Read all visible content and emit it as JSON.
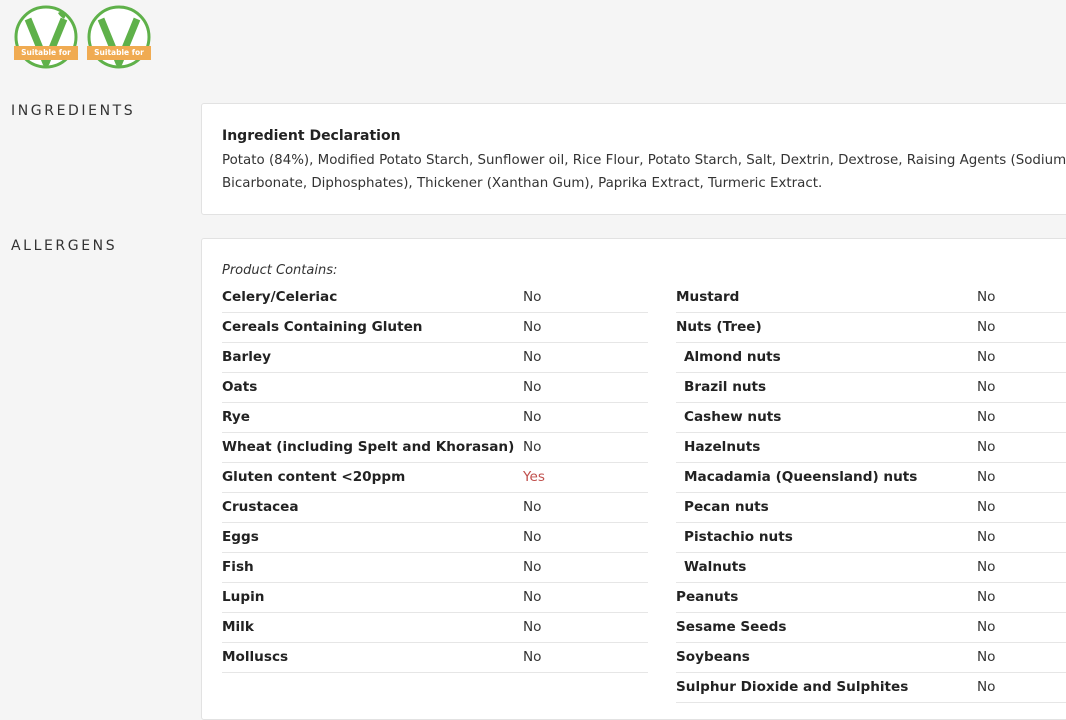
{
  "badges": [
    {
      "label": "Suitable for",
      "icon": "vegetarian-v-icon",
      "color": "#5fb14a",
      "accent": "#f0ab52"
    },
    {
      "label": "Suitable for",
      "icon": "vegan-v-icon",
      "color": "#5fb14a",
      "accent": "#f0ab52"
    }
  ],
  "ingredients": {
    "heading": "INGREDIENTS",
    "declaration_title": "Ingredient Declaration",
    "declaration_text": "Potato (84%), Modified Potato Starch, Sunflower oil, Rice Flour, Potato Starch, Salt, Dextrin, Dextrose, Raising Agents (Sodium Bicarbonate, Diphosphates), Thickener (Xanthan Gum), Paprika Extract, Turmeric Extract."
  },
  "allergens": {
    "heading": "ALLERGENS",
    "contains_label": "Product Contains:",
    "left": [
      {
        "name": "Celery/Celeriac",
        "value": "No"
      },
      {
        "name": "Cereals Containing Gluten",
        "value": "No"
      },
      {
        "name": "Barley",
        "value": "No"
      },
      {
        "name": "Oats",
        "value": "No"
      },
      {
        "name": "Rye",
        "value": "No"
      },
      {
        "name": "Wheat (including Spelt and Khorasan)",
        "value": "No"
      },
      {
        "name": "Gluten content <20ppm",
        "value": "Yes"
      },
      {
        "name": "Crustacea",
        "value": "No"
      },
      {
        "name": "Eggs",
        "value": "No"
      },
      {
        "name": "Fish",
        "value": "No"
      },
      {
        "name": "Lupin",
        "value": "No"
      },
      {
        "name": "Milk",
        "value": "No"
      },
      {
        "name": "Molluscs",
        "value": "No"
      }
    ],
    "right": [
      {
        "name": "Mustard",
        "value": "No"
      },
      {
        "name": "Nuts (Tree)",
        "value": "No"
      },
      {
        "name": "Almond nuts",
        "value": "No"
      },
      {
        "name": "Brazil nuts",
        "value": "No"
      },
      {
        "name": "Cashew nuts",
        "value": "No"
      },
      {
        "name": "Hazelnuts",
        "value": "No"
      },
      {
        "name": "Macadamia (Queensland) nuts",
        "value": "No"
      },
      {
        "name": "Pecan nuts",
        "value": "No"
      },
      {
        "name": "Pistachio nuts",
        "value": "No"
      },
      {
        "name": "Walnuts",
        "value": "No"
      },
      {
        "name": "Peanuts",
        "value": "No"
      },
      {
        "name": "Sesame Seeds",
        "value": "No"
      },
      {
        "name": "Soybeans",
        "value": "No"
      },
      {
        "name": "Sulphur Dioxide and Sulphites",
        "value": "No"
      }
    ],
    "yes_color": "#c0504d"
  }
}
